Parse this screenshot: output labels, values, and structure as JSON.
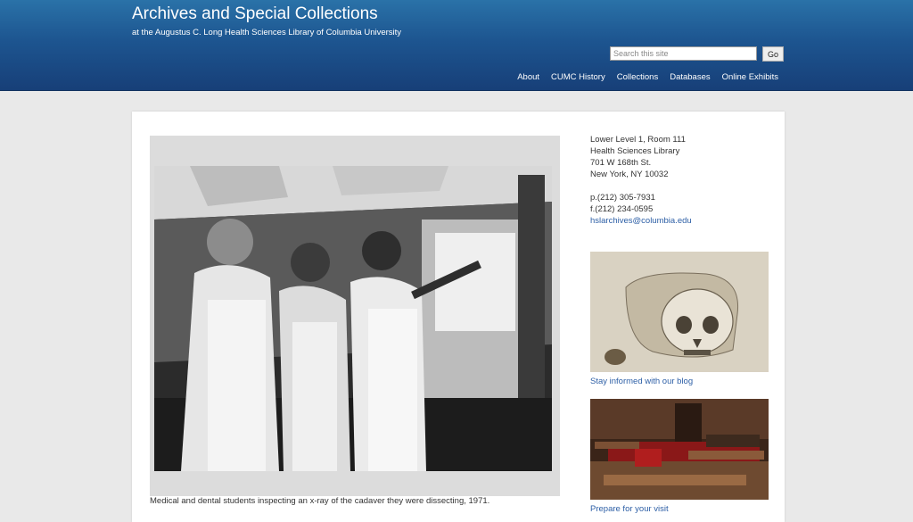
{
  "header": {
    "title": "Archives and Special Collections",
    "subtitle": "at the Augustus C. Long Health Sciences Library of Columbia University",
    "brand_color": "#1d5590"
  },
  "search": {
    "placeholder": "Search this site",
    "value": "",
    "button_label": "Go"
  },
  "nav": {
    "items": [
      {
        "label": "About"
      },
      {
        "label": "CUMC History"
      },
      {
        "label": "Collections"
      },
      {
        "label": "Databases"
      },
      {
        "label": "Online Exhibits"
      }
    ]
  },
  "hero": {
    "caption": "Medical and dental students inspecting an x-ray of the cadaver they were dissecting, 1971."
  },
  "sidebar": {
    "address": [
      "Lower Level 1, Room 111",
      "Health Sciences Library",
      "701 W 168th St.",
      "New York, NY 10032"
    ],
    "phone": "p.(212) 305-7931",
    "fax": "f.(212) 234-0595",
    "email": "hslarchives@columbia.edu",
    "link_color": "#2d5fa6"
  },
  "promos": {
    "blog_label": "Stay informed with our blog",
    "visit_label": "Prepare for your visit"
  }
}
